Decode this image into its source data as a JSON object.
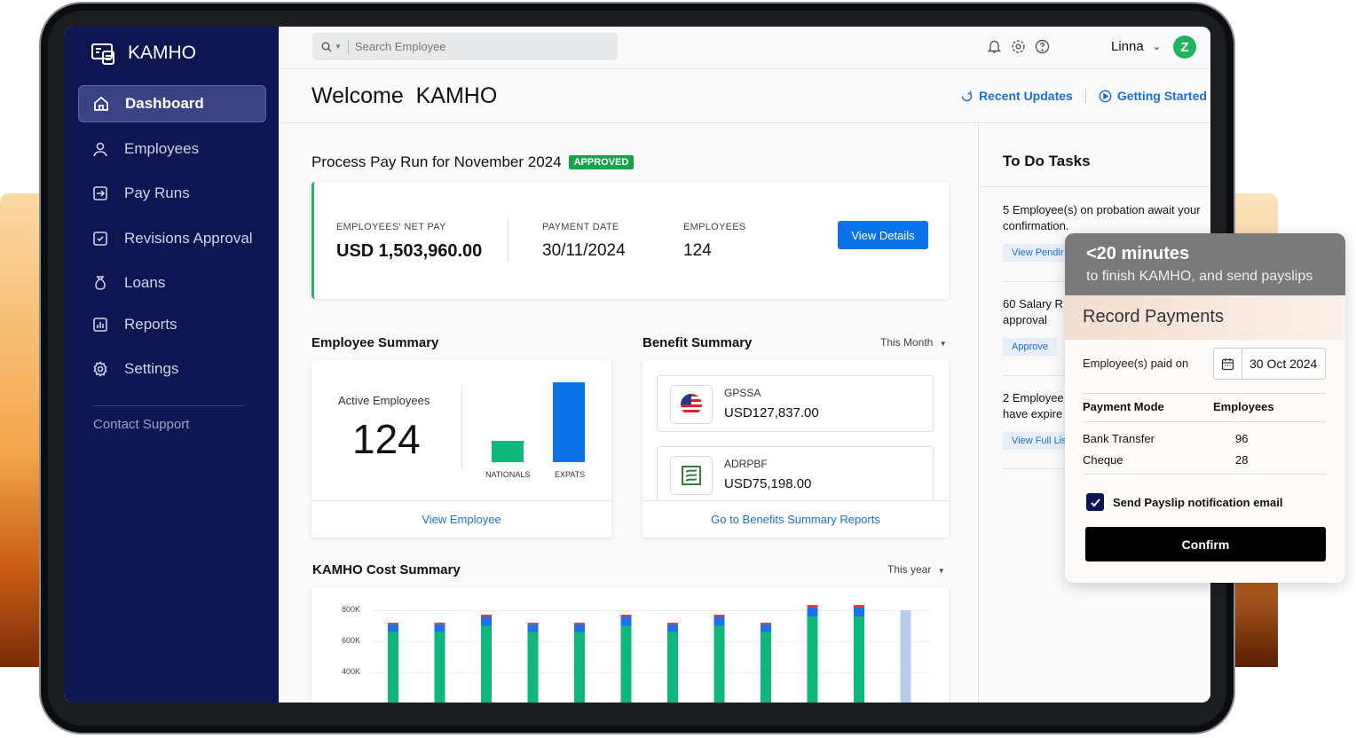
{
  "app": {
    "name": "KAMHO"
  },
  "sidebar": {
    "items": [
      {
        "label": "Dashboard",
        "icon": "home-icon"
      },
      {
        "label": "Employees",
        "icon": "user-icon"
      },
      {
        "label": "Pay Runs",
        "icon": "payrun-icon"
      },
      {
        "label": "Revisions Approval",
        "icon": "check-square-icon"
      },
      {
        "label": "Loans",
        "icon": "money-bag-icon"
      },
      {
        "label": "Reports",
        "icon": "chart-icon"
      },
      {
        "label": "Settings",
        "icon": "gear-icon"
      }
    ],
    "contact": "Contact Support"
  },
  "topbar": {
    "search_placeholder": "Search Employee",
    "user": "Linna",
    "avatar": "Z"
  },
  "header": {
    "welcome": "Welcome  KAMHO",
    "recent_updates": "Recent Updates",
    "getting_started": "Getting Started"
  },
  "payrun": {
    "title": "Process Pay Run for November 2024",
    "status": "APPROVED",
    "net_pay_label": "EMPLOYEES' NET PAY",
    "net_pay_currency": "USD",
    "net_pay_value": "1,503,960.00",
    "payment_date_label": "PAYMENT DATE",
    "payment_date": "30/11/2024",
    "employees_label": "EMPLOYEES",
    "employees": "124",
    "button": "View Details"
  },
  "employee_summary": {
    "title": "Employee Summary",
    "active_label": "Active Employees",
    "active_count": "124",
    "bar_labels": [
      "NATIONALS",
      "EXPATS"
    ],
    "link": "View Employee"
  },
  "benefit_summary": {
    "title": "Benefit Summary",
    "period": "This Month",
    "items": [
      {
        "name": "GPSSA",
        "amount": "USD127,837.00"
      },
      {
        "name": "ADRPBF",
        "amount": "USD75,198.00"
      }
    ],
    "link": "Go to Benefits Summary Reports"
  },
  "cost_summary": {
    "title": "KAMHO Cost Summary",
    "period": "This year",
    "y_ticks": [
      "800K",
      "600K",
      "400K"
    ]
  },
  "chart_data": {
    "type": "bar",
    "title": "KAMHO Cost Summary",
    "ylim": [
      300000,
      800000
    ],
    "y_ticks": [
      800000,
      600000,
      400000
    ],
    "series": [
      {
        "values": [
          660000,
          660000,
          700000,
          660000,
          660000,
          700000,
          660000,
          700000,
          660000,
          760000,
          760000,
          0
        ]
      },
      {
        "values": [
          50000,
          50000,
          60000,
          50000,
          50000,
          60000,
          50000,
          60000,
          50000,
          60000,
          60000,
          0
        ]
      },
      {
        "values": [
          10000,
          10000,
          12000,
          10000,
          10000,
          12000,
          10000,
          12000,
          10000,
          14000,
          14000,
          0
        ]
      },
      {
        "values": [
          0,
          0,
          0,
          0,
          0,
          0,
          0,
          0,
          0,
          0,
          0,
          800000
        ]
      }
    ],
    "colors": [
      "#0fb87a",
      "#1a73e8",
      "#e53935",
      "#b7cdf0"
    ]
  },
  "todo": {
    "title": "To Do Tasks",
    "items": [
      {
        "text": "5 Employee(s) on probation await your confirmation.",
        "button": "View Pendir"
      },
      {
        "text": "60 Salary R approval",
        "button": "Approve"
      },
      {
        "text": "2 Employee have expire",
        "button": "View Full Lis"
      }
    ]
  },
  "popup": {
    "headline": "<20 minutes",
    "subline": "to finish KAMHO, and send payslips",
    "title": "Record Payments",
    "paid_on_label": "Employee(s) paid on",
    "paid_on_date": "30 Oct 2024",
    "col_mode": "Payment Mode",
    "col_employees": "Employees",
    "rows": [
      {
        "mode": "Bank Transfer",
        "count": "96"
      },
      {
        "mode": "Cheque",
        "count": "28"
      }
    ],
    "notify_label": "Send Payslip notification email",
    "notify_checked": true,
    "confirm": "Confirm"
  }
}
